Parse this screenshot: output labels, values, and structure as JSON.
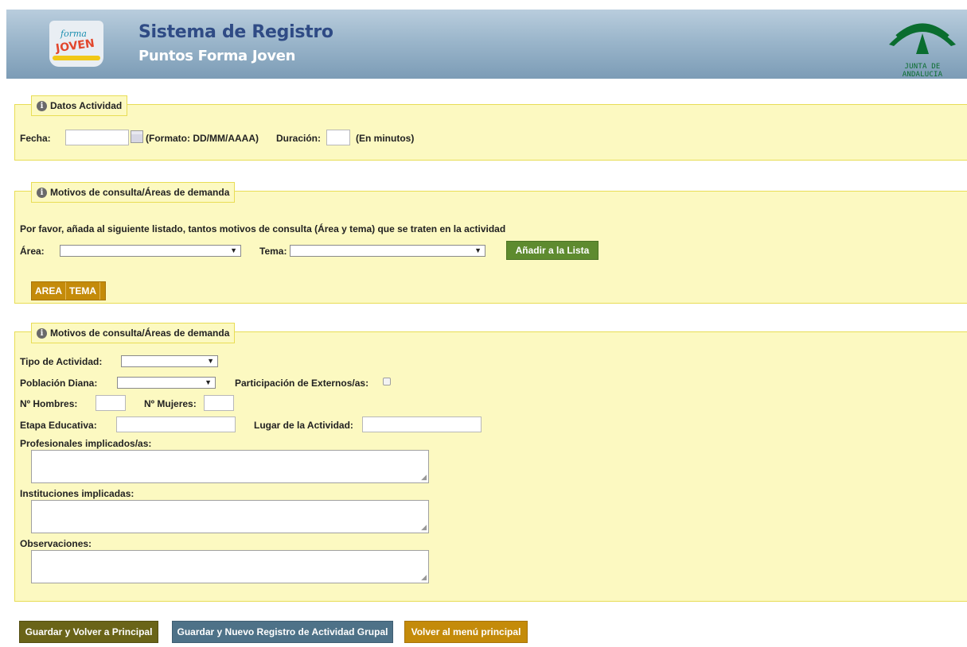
{
  "header": {
    "logo_line1": "forma",
    "logo_line2": "JOVEN",
    "title": "Sistema de Registro",
    "subtitle": "Puntos Forma Joven",
    "gov_logo_text": "JUNTA DE ANDALUCIA"
  },
  "datos": {
    "legend": "Datos Actividad",
    "fecha_label": "Fecha:",
    "fecha_value": "",
    "formato_hint": "(Formato: DD/MM/AAAA)",
    "duracion_label": "Duración:",
    "duracion_value": "",
    "minutos_hint": "(En minutos)"
  },
  "motivos": {
    "legend": "Motivos de consulta/Áreas de demanda",
    "instructions": "Por favor, añada al siguiente listado, tantos motivos de consulta (Área y tema) que se traten en la actividad",
    "area_label": "Área:",
    "area_value": "",
    "tema_label": "Tema:",
    "tema_value": "",
    "add_button": "Añadir a la Lista",
    "table_columns": [
      "AREA",
      "TEMA"
    ]
  },
  "detalles": {
    "legend": "Motivos de consulta/Áreas de demanda",
    "tipo_label": "Tipo de Actividad:",
    "tipo_value": "",
    "poblacion_label": "Población Diana:",
    "poblacion_value": "",
    "externos_label": "Participación de Externos/as:",
    "externos_checked": false,
    "hombres_label": "Nº Hombres:",
    "mujeres_label": "Nº Mujeres:",
    "etapa_label": "Etapa Educativa:",
    "lugar_label": "Lugar de la Actividad:",
    "profesionales_label": "Profesionales implicados/as:",
    "instituciones_label": "Instituciones implicadas:",
    "observaciones_label": "Observaciones:"
  },
  "actions": {
    "guardar_volver": "Guardar y Volver a Principal",
    "guardar_nuevo": "Guardar y Nuevo Registro de Actividad Grupal",
    "volver_menu": "Volver al menú principal"
  },
  "colors": {
    "panel_bg": "#fcf9c1",
    "panel_border": "#e8dd55",
    "btn_green": "#5e8b2f",
    "btn_olive": "#6a6418",
    "btn_blue": "#4e7288",
    "btn_orange": "#c48b0a"
  }
}
